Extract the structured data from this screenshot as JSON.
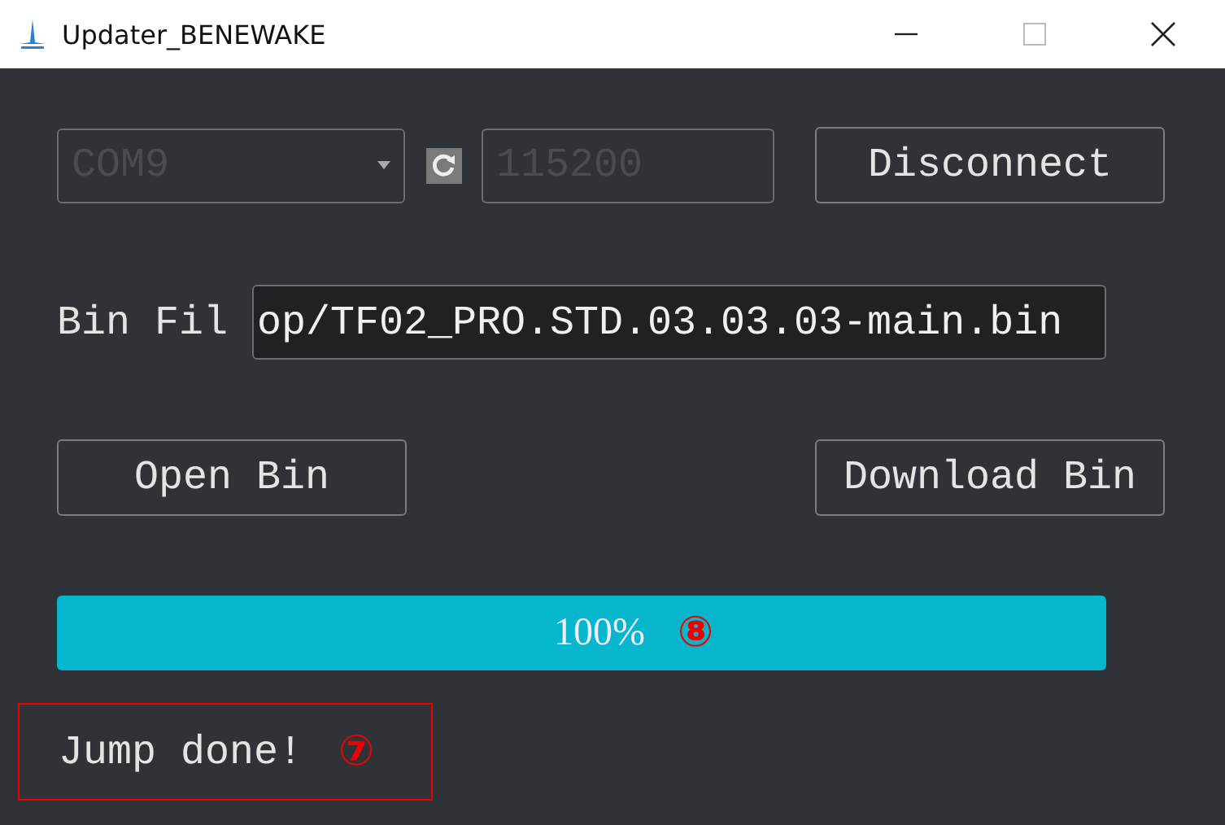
{
  "window": {
    "title": "Updater_BENEWAKE"
  },
  "port": {
    "value": "COM9",
    "disabled": true
  },
  "baud": {
    "value": "115200",
    "disabled": true
  },
  "connect_button": {
    "label": "Disconnect"
  },
  "bin_file": {
    "label": "Bin Fil",
    "value": "op/TF02_PRO.STD.03.03.03-main.bin"
  },
  "buttons": [
    {
      "label": "Open Bin"
    },
    {
      "label": "Download Bin"
    }
  ],
  "progress": {
    "text": "100%",
    "annotation": "⑧"
  },
  "status": {
    "text": "Jump done!",
    "annotation": "⑦",
    "highlighted": true
  }
}
